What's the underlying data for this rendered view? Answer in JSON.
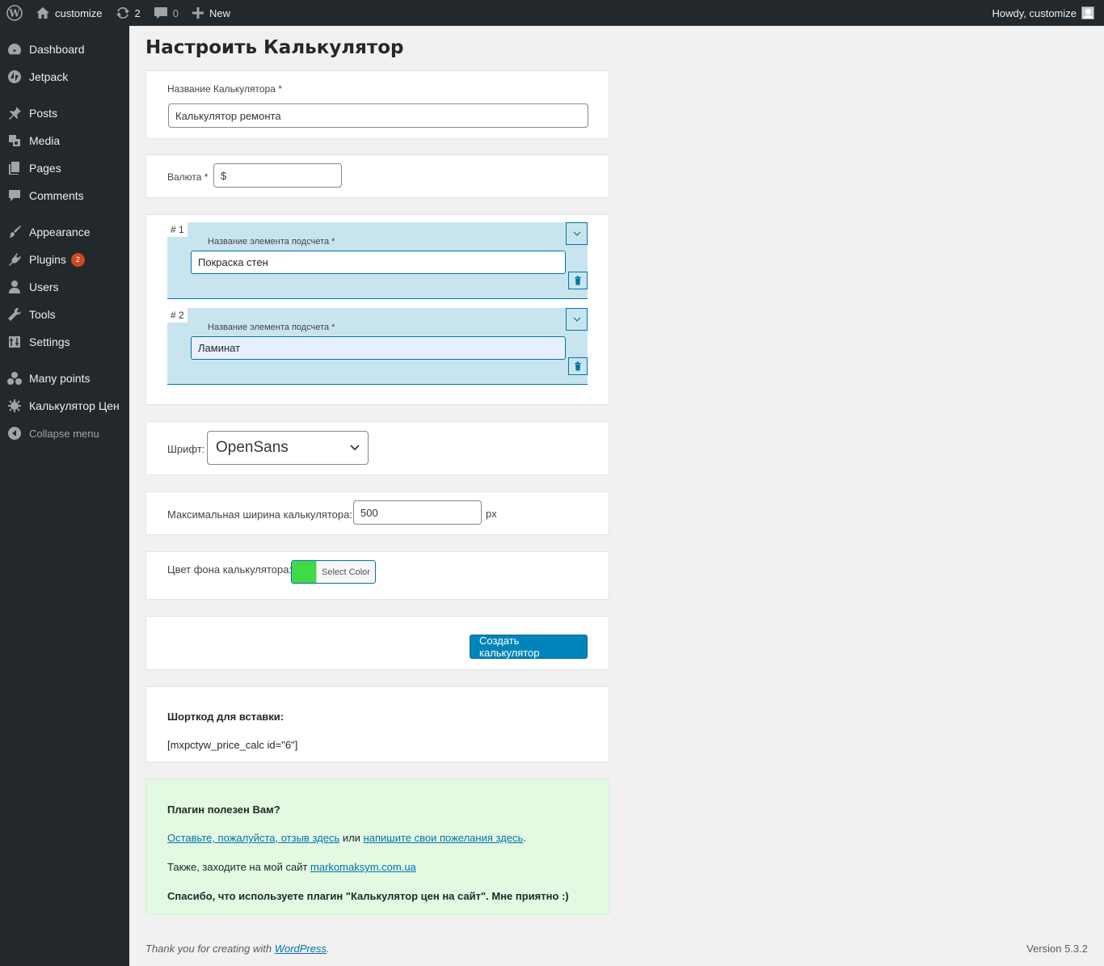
{
  "adminbar": {
    "site_name": "customize",
    "updates_count": "2",
    "comments_count": "0",
    "new_label": "New",
    "howdy": "Howdy, customize"
  },
  "sidebar": {
    "items": [
      {
        "label": "Dashboard",
        "icon": "dashboard-icon"
      },
      {
        "label": "Jetpack",
        "icon": "jetpack-icon"
      },
      {
        "label": "Posts",
        "icon": "pin-icon"
      },
      {
        "label": "Media",
        "icon": "media-icon"
      },
      {
        "label": "Pages",
        "icon": "pages-icon"
      },
      {
        "label": "Comments",
        "icon": "comment-icon"
      },
      {
        "label": "Appearance",
        "icon": "brush-icon"
      },
      {
        "label": "Plugins",
        "icon": "plugin-icon",
        "badge": "2"
      },
      {
        "label": "Users",
        "icon": "user-icon"
      },
      {
        "label": "Tools",
        "icon": "wrench-icon"
      },
      {
        "label": "Settings",
        "icon": "settings-icon"
      },
      {
        "label": "Many points",
        "icon": "points-icon"
      },
      {
        "label": "Калькулятор Цен",
        "icon": "calculator-icon"
      },
      {
        "label": "Collapse menu",
        "icon": "collapse-icon"
      }
    ]
  },
  "page": {
    "title": "Настроить Калькулятор"
  },
  "calc_name": {
    "label": "Название Калькулятора *",
    "value": "Калькулятор ремонта"
  },
  "currency": {
    "label": "Валюта *",
    "value": "$"
  },
  "elements": [
    {
      "num": "# 1",
      "label": "Название элемента подсчета *",
      "value": "Покраска стен"
    },
    {
      "num": "# 2",
      "label": "Название элемента подсчета *",
      "value": "Ламинат"
    }
  ],
  "font": {
    "label": "Шрифт:",
    "value": "OpenSans"
  },
  "max_width": {
    "label": "Максимальная ширина калькулятора:",
    "value": "500",
    "unit": "px"
  },
  "bg_color": {
    "label": "Цвет фона калькулятора:",
    "button": "Select Color",
    "color": "#3fdb47"
  },
  "create_button": "Создать калькулятор",
  "shortcode": {
    "title": "Шорткод для вставки:",
    "code": "[mxpctyw_price_calc id=\"6\"]"
  },
  "feedback": {
    "title": "Плагин полезен Вам?",
    "link1": "Оставьте, пожалуйста, отзыв здесь",
    "or": " или ",
    "link2": "напишите свои пожелания здесь",
    "dot": ".",
    "site_text": "Также, заходите на мой сайт ",
    "site_link": "markomaksym.com.ua",
    "thanks": "Спасибо, что используете плагин \"Калькулятор цен на сайт\". Мне приятно :)"
  },
  "footer": {
    "thanks_text": "Thank you for creating with ",
    "wp_link": "WordPress",
    "dot": ".",
    "version": "Version 5.3.2"
  }
}
